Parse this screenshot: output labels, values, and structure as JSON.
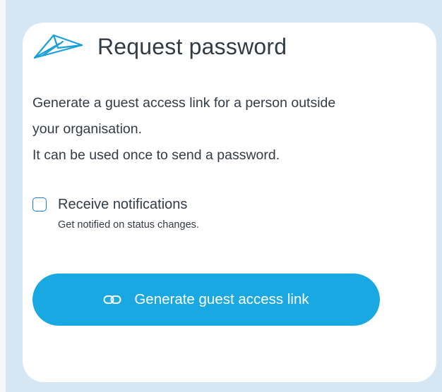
{
  "header": {
    "icon": "paper-plane-icon",
    "title": "Request password"
  },
  "description": {
    "line1": "Generate a guest access link for a person outside your organisation.",
    "line2": "It can be used once to send a password."
  },
  "notifications": {
    "label": "Receive notifications",
    "hint": "Get notified on status changes.",
    "checked": false
  },
  "action": {
    "icon": "link-icon",
    "label": "Generate guest access link"
  },
  "colors": {
    "background": "#d6e7f3",
    "accent": "#1aa8e2",
    "checkbox_border": "#1c7fc3",
    "text": "#333b43"
  }
}
